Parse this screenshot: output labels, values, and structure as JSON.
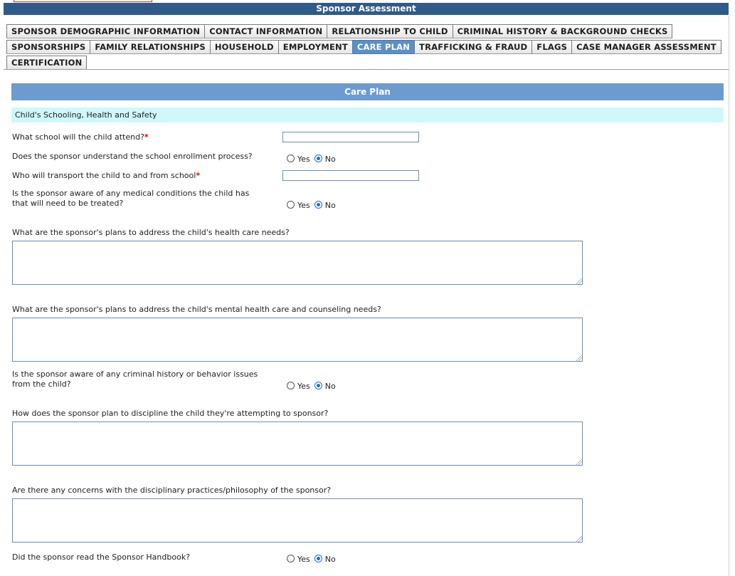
{
  "window": {
    "title": "Sponsor Assessment"
  },
  "tabs": {
    "row1": [
      "SPONSOR DEMOGRAPHIC INFORMATION",
      "CONTACT INFORMATION",
      "RELATIONSHIP TO CHILD",
      "CRIMINAL HISTORY & BACKGROUND CHECKS"
    ],
    "row2": [
      "SPONSORSHIPS",
      "FAMILY RELATIONSHIPS",
      "HOUSEHOLD",
      "EMPLOYMENT",
      "CARE PLAN",
      "TRAFFICKING & FRAUD",
      "FLAGS",
      "CASE MANAGER ASSESSMENT"
    ],
    "row3": [
      "CERTIFICATION"
    ],
    "active": "CARE PLAN"
  },
  "section": {
    "title": "Care Plan",
    "subhead": "Child's Schooling, Health and Safety"
  },
  "radio": {
    "yes": "Yes",
    "no": "No"
  },
  "questions": {
    "school": {
      "label": "What school will the child attend?",
      "required": "*",
      "value": ""
    },
    "enrollment": {
      "label": "Does the sponsor understand the school enrollment process?",
      "selected": "No"
    },
    "transport": {
      "label": "Who will transport the child to and from school",
      "required": "*",
      "value": ""
    },
    "medical": {
      "label": "Is the sponsor aware of any medical conditions the child has that will need to be treated?",
      "selected": "No"
    },
    "health_plan": {
      "label": "What are the sponsor's plans to address the child's health care needs?",
      "value": ""
    },
    "mental_plan": {
      "label": "What are the sponsor's plans to address the child's mental health care and counseling needs?",
      "value": ""
    },
    "criminal": {
      "label": "Is the sponsor aware of any criminal history or behavior issues from the child?",
      "selected": "No"
    },
    "discipline": {
      "label": "How does the sponsor plan to discipline the child they're attempting to sponsor?",
      "value": ""
    },
    "concerns": {
      "label": "Are there any concerns with the disciplinary practices/philosophy of the sponsor?",
      "value": ""
    },
    "handbook": {
      "label": "Did the sponsor read the Sponsor Handbook?",
      "selected": "No"
    }
  },
  "colors": {
    "titlebar": "#2f5b8a",
    "section_bar": "#6c9bd0",
    "subhead_bg": "#cff8fb",
    "active_tab": "#5b8fc7",
    "required": "#dd0000"
  }
}
